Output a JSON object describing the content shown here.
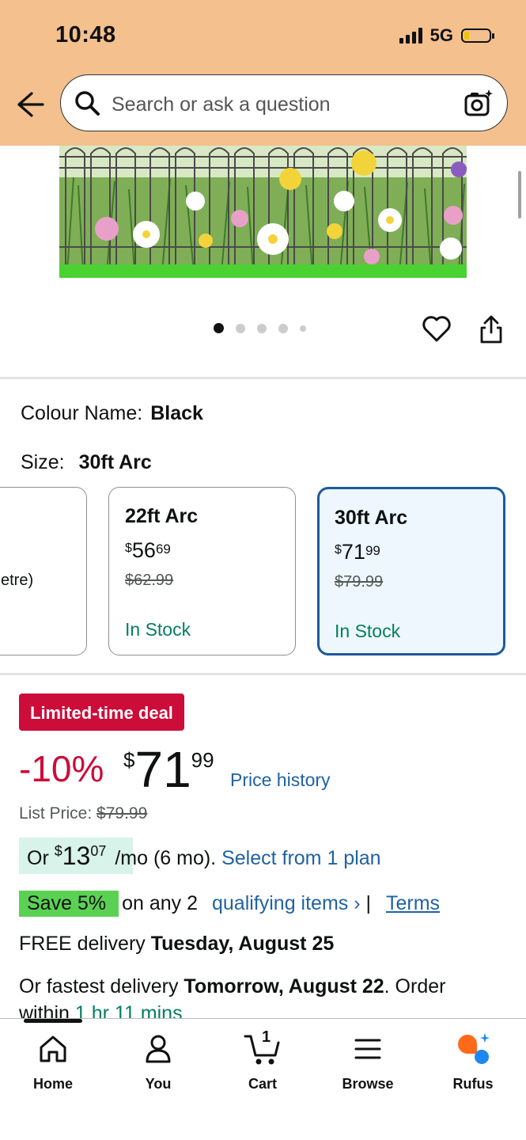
{
  "status_bar": {
    "time": "10:48",
    "network": "5G"
  },
  "search": {
    "placeholder": "Search or ask a question"
  },
  "product": {
    "colour_label": "Colour Name:",
    "colour_value": "Black",
    "size_label": "Size:",
    "size_value": "30ft Arc",
    "gallery": {
      "image_count": 5,
      "active_index": 0
    }
  },
  "size_options": [
    {
      "partial_text": "etre)"
    },
    {
      "name": "22ft Arc",
      "currency": "$",
      "whole": "56",
      "cents": "69",
      "original": "$62.99",
      "stock": "In Stock"
    },
    {
      "name": "30ft Arc",
      "currency": "$",
      "whole": "71",
      "cents": "99",
      "original": "$79.99",
      "stock": "In Stock"
    }
  ],
  "deal": {
    "badge": "Limited-time deal",
    "discount": "-10%",
    "currency": "$",
    "whole": "71",
    "cents": "99",
    "price_history": "Price history",
    "list_price_label": "List Price:",
    "list_price": "$79.99"
  },
  "installment": {
    "prefix": "Or",
    "currency": "$",
    "whole": "13",
    "cents": "07",
    "suffix": "/mo (6 mo).",
    "link": "Select from 1 plan"
  },
  "promo": {
    "badge": "Save 5%",
    "text": "on any 2",
    "link": "qualifying items ›",
    "sep": "|",
    "terms": "Terms"
  },
  "delivery": {
    "free_prefix": "FREE delivery",
    "free_date": "Tuesday, August 25",
    "fast_prefix": "Or fastest delivery",
    "fast_date": "Tomorrow, August 22",
    "fast_suffix": ". Order",
    "within_prefix": "within",
    "within_time": "1 hr 11 mins"
  },
  "bottom_nav": [
    {
      "label": "Home",
      "icon": "home-icon"
    },
    {
      "label": "You",
      "icon": "person-icon"
    },
    {
      "label": "Cart",
      "icon": "cart-icon",
      "badge": "1"
    },
    {
      "label": "Browse",
      "icon": "menu-icon"
    },
    {
      "label": "Rufus",
      "icon": "rufus-icon"
    }
  ],
  "colors": {
    "header_bg": "#f3c08e",
    "deal_red": "#cc0c39",
    "link_blue": "#2162a1",
    "stock_green": "#067d62",
    "save_green": "#5bd154",
    "selected_border": "#1d5a9a"
  }
}
